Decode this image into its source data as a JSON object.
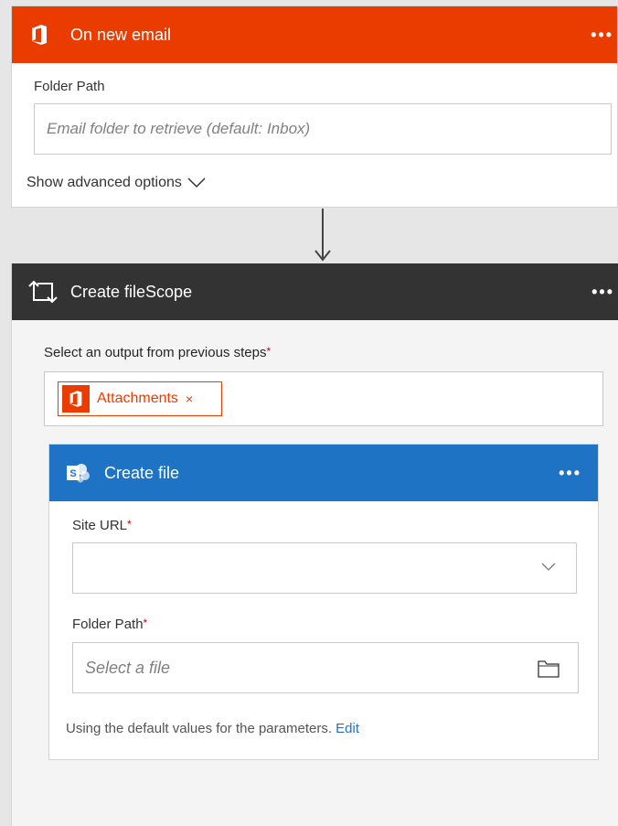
{
  "trigger": {
    "title": "On new email",
    "more_label": "•••",
    "folder_path_label": "Folder Path",
    "folder_path_placeholder": "Email folder to retrieve (default: Inbox)",
    "advanced_label": "Show advanced options",
    "accent_color": "#eb3c00",
    "icon": "office365-icon"
  },
  "scope": {
    "title": "Create fileScope",
    "more_label": "•••",
    "output_label": "Select an output from previous steps",
    "required_marker": "*",
    "token_label": "Attachments",
    "token_remove": "×",
    "header_color": "#333333",
    "icon": "apply-to-each-icon"
  },
  "create_file": {
    "title": "Create file",
    "more_label": "•••",
    "site_url_label": "Site URL",
    "site_url_value": "",
    "folder_path_label": "Folder Path",
    "folder_path_placeholder": "Select a file",
    "defaults_note": "Using the default values for the parameters.",
    "edit_link": "Edit",
    "header_color": "#1f73c4",
    "icon": "sharepoint-icon"
  }
}
